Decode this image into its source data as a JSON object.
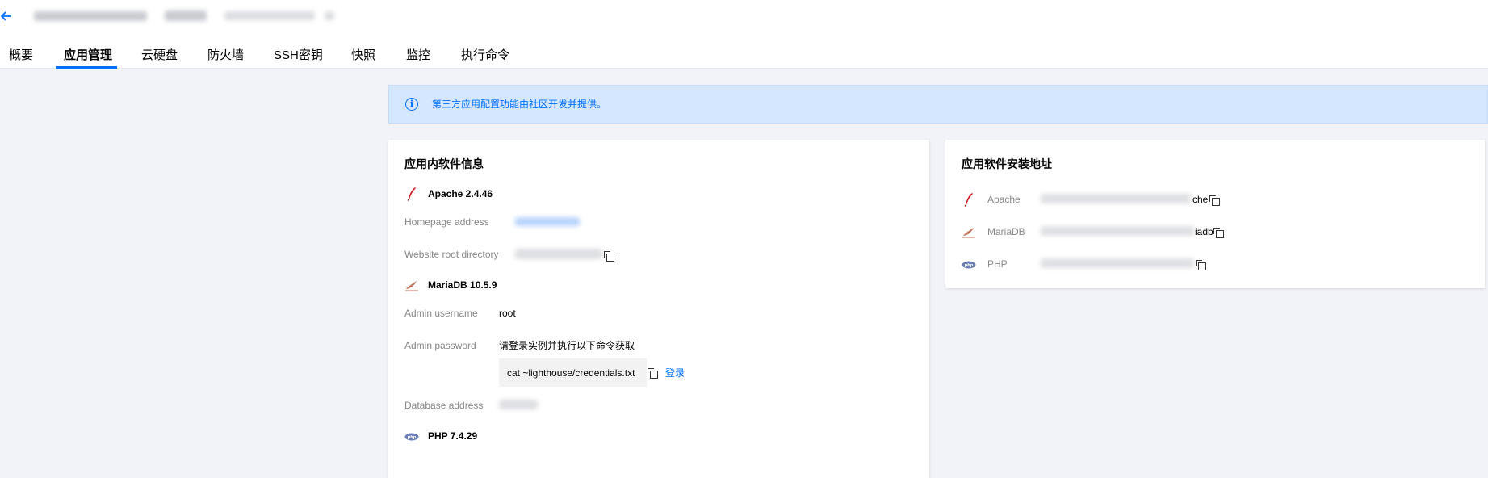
{
  "header": {
    "back_icon": "arrow-left-icon"
  },
  "tabs": [
    {
      "label": "概要",
      "active": false
    },
    {
      "label": "应用管理",
      "active": true
    },
    {
      "label": "云硬盘",
      "active": false
    },
    {
      "label": "防火墙",
      "active": false
    },
    {
      "label": "SSH密钥",
      "active": false
    },
    {
      "label": "快照",
      "active": false
    },
    {
      "label": "监控",
      "active": false
    },
    {
      "label": "执行命令",
      "active": false
    }
  ],
  "notice": {
    "icon": "info-icon",
    "text": "第三方应用配置功能由社区开发并提供。"
  },
  "software_info": {
    "title": "应用内软件信息",
    "apache": {
      "name": "Apache 2.4.46",
      "icon": "apache-feather-icon",
      "homepage_label": "Homepage address",
      "root_label": "Website root directory"
    },
    "mariadb": {
      "name": "MariaDB 10.5.9",
      "icon": "mariadb-seal-icon",
      "username_label": "Admin username",
      "username_value": "root",
      "password_label": "Admin password",
      "password_hint": "请登录实例并执行以下命令获取",
      "command": "cat ~lighthouse/credentials.txt",
      "login_link": "登录",
      "db_address_label": "Database address"
    },
    "php": {
      "name": "PHP 7.4.29",
      "icon": "php-logo-icon"
    }
  },
  "install_paths": {
    "title": "应用软件安装地址",
    "items": [
      {
        "label": "Apache",
        "visible_suffix": "che",
        "icon": "apache-feather-icon"
      },
      {
        "label": "MariaDB",
        "visible_suffix": "iadb",
        "icon": "mariadb-seal-icon"
      },
      {
        "label": "PHP",
        "visible_suffix": "",
        "icon": "php-logo-icon"
      }
    ]
  },
  "colors": {
    "accent": "#006eff",
    "notice_bg": "#d5e7ff",
    "page_bg": "#f2f3f8",
    "label_gray": "#888888"
  }
}
